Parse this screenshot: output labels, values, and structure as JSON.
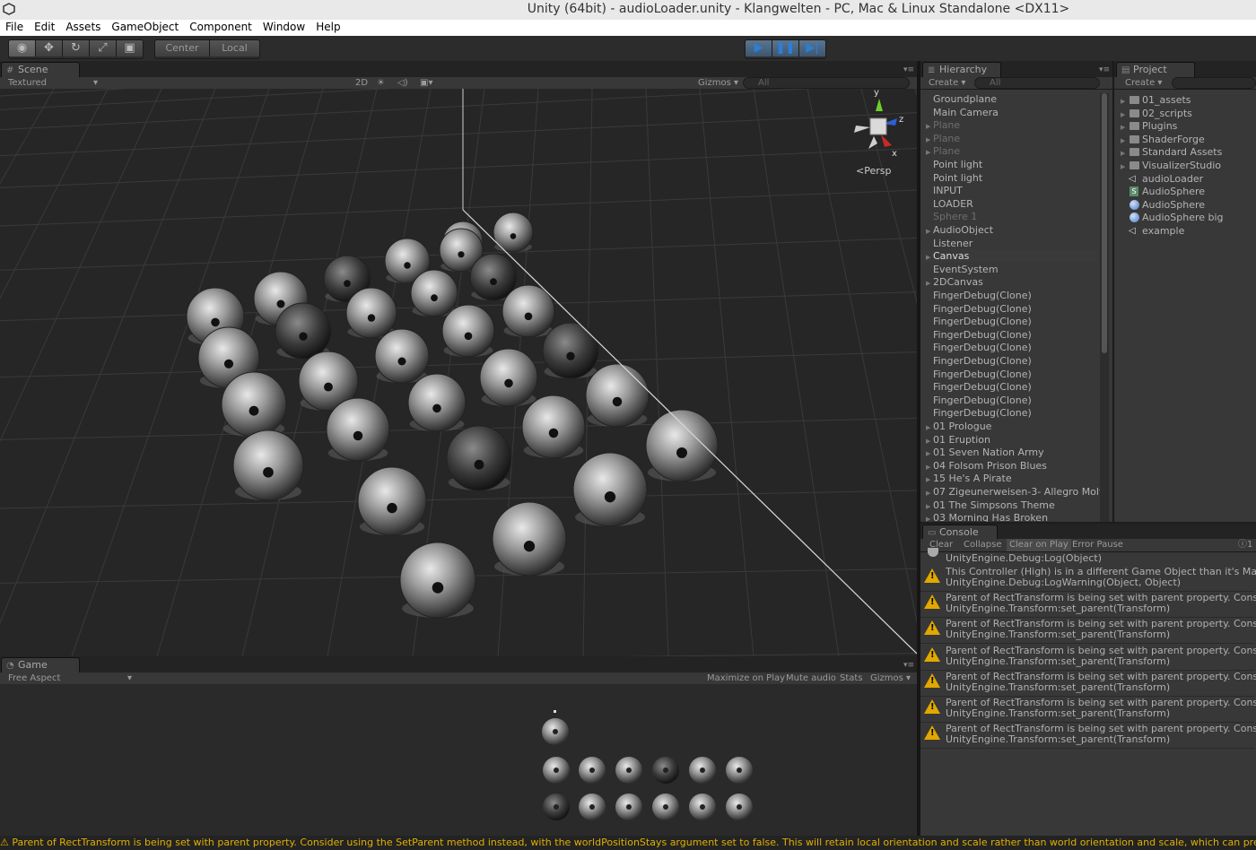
{
  "window": {
    "title": "Unity (64bit) - audioLoader.unity - Klangwelten - PC, Mac & Linux Standalone <DX11>"
  },
  "menu": [
    "File",
    "Edit",
    "Assets",
    "GameObject",
    "Component",
    "Window",
    "Help"
  ],
  "toolbar": {
    "pivot_label": "Center",
    "space_label": "Local"
  },
  "scene": {
    "tab_label": "Scene",
    "shading_mode": "Textured",
    "mode_2d": "2D",
    "gizmos_label": "Gizmos",
    "search_placeholder": "All",
    "persp_label": "Persp",
    "axis_y": "y",
    "axis_z": "z",
    "axis_x": "x"
  },
  "game": {
    "tab_label": "Game",
    "aspect": "Free Aspect",
    "maximize_on_play": "Maximize on Play",
    "mute_audio": "Mute audio",
    "stats": "Stats",
    "gizmos": "Gizmos"
  },
  "hierarchy": {
    "tab_label": "Hierarchy",
    "create_label": "Create",
    "search_placeholder": "All",
    "items": [
      {
        "label": "Groundplane",
        "arrow": false,
        "dim": false
      },
      {
        "label": "Main Camera",
        "arrow": false,
        "dim": false
      },
      {
        "label": "Plane",
        "arrow": true,
        "dim": true
      },
      {
        "label": "Plane",
        "arrow": true,
        "dim": true
      },
      {
        "label": "Plane",
        "arrow": true,
        "dim": true
      },
      {
        "label": "Point light",
        "arrow": false,
        "dim": false
      },
      {
        "label": "Point light",
        "arrow": false,
        "dim": false
      },
      {
        "label": "INPUT",
        "arrow": false,
        "dim": false
      },
      {
        "label": "LOADER",
        "arrow": false,
        "dim": false
      },
      {
        "label": "Sphere 1",
        "arrow": false,
        "dim": true
      },
      {
        "label": "AudioObject",
        "arrow": true,
        "dim": false
      },
      {
        "label": "Listener",
        "arrow": false,
        "dim": false
      },
      {
        "label": "Canvas",
        "arrow": true,
        "dim": false
      },
      {
        "label": "EventSystem",
        "arrow": false,
        "dim": false
      },
      {
        "label": "2DCanvas",
        "arrow": true,
        "dim": false
      },
      {
        "label": "FingerDebug(Clone)",
        "arrow": false,
        "dim": false
      },
      {
        "label": "FingerDebug(Clone)",
        "arrow": false,
        "dim": false
      },
      {
        "label": "FingerDebug(Clone)",
        "arrow": false,
        "dim": false
      },
      {
        "label": "FingerDebug(Clone)",
        "arrow": false,
        "dim": false
      },
      {
        "label": "FingerDebug(Clone)",
        "arrow": false,
        "dim": false
      },
      {
        "label": "FingerDebug(Clone)",
        "arrow": false,
        "dim": false
      },
      {
        "label": "FingerDebug(Clone)",
        "arrow": false,
        "dim": false
      },
      {
        "label": "FingerDebug(Clone)",
        "arrow": false,
        "dim": false
      },
      {
        "label": "FingerDebug(Clone)",
        "arrow": false,
        "dim": false
      },
      {
        "label": "FingerDebug(Clone)",
        "arrow": false,
        "dim": false
      },
      {
        "label": "01 Prologue",
        "arrow": true,
        "dim": false
      },
      {
        "label": "01 Eruption",
        "arrow": true,
        "dim": false
      },
      {
        "label": "01 Seven Nation Army",
        "arrow": true,
        "dim": false
      },
      {
        "label": "04 Folsom Prison Blues",
        "arrow": true,
        "dim": false
      },
      {
        "label": "15 He's A Pirate",
        "arrow": true,
        "dim": false
      },
      {
        "label": "07 Zigeunerweisen-3- Allegro Molto",
        "arrow": true,
        "dim": false
      },
      {
        "label": "01 The Simpsons Theme",
        "arrow": true,
        "dim": false
      },
      {
        "label": "03 Morning Has Broken",
        "arrow": true,
        "dim": false
      }
    ],
    "selected_index": 12
  },
  "project": {
    "tab_label": "Project",
    "create_label": "Create",
    "items": [
      {
        "label": "01_assets",
        "kind": "folder"
      },
      {
        "label": "02_scripts",
        "kind": "folder"
      },
      {
        "label": "Plugins",
        "kind": "folder"
      },
      {
        "label": "ShaderForge",
        "kind": "folder"
      },
      {
        "label": "Standard Assets",
        "kind": "folder"
      },
      {
        "label": "VisualizerStudio",
        "kind": "folder"
      },
      {
        "label": "audioLoader",
        "kind": "scene"
      },
      {
        "label": "AudioSphere",
        "kind": "script"
      },
      {
        "label": "AudioSphere",
        "kind": "material"
      },
      {
        "label": "AudioSphere big",
        "kind": "material"
      },
      {
        "label": "example",
        "kind": "scene"
      }
    ]
  },
  "console": {
    "tab_label": "Console",
    "buttons": [
      "Clear",
      "Collapse",
      "Clear on Play",
      "Error Pause"
    ],
    "info_count": "1",
    "first_line": "UnityEngine.Debug:Log(Object)",
    "entries": [
      {
        "line1": "This Controller (High) is in a different Game Object than it's Manag",
        "line2": "UnityEngine.Debug:LogWarning(Object, Object)"
      },
      {
        "line1": "Parent of RectTransform is being set with parent property. Conside",
        "line2": "UnityEngine.Transform:set_parent(Transform)"
      },
      {
        "line1": "Parent of RectTransform is being set with parent property. Conside",
        "line2": "UnityEngine.Transform:set_parent(Transform)"
      },
      {
        "line1": "Parent of RectTransform is being set with parent property. Conside",
        "line2": "UnityEngine.Transform:set_parent(Transform)"
      },
      {
        "line1": "Parent of RectTransform is being set with parent property. Conside",
        "line2": "UnityEngine.Transform:set_parent(Transform)"
      },
      {
        "line1": "Parent of RectTransform is being set with parent property. Conside",
        "line2": "UnityEngine.Transform:set_parent(Transform)"
      },
      {
        "line1": "Parent of RectTransform is being set with parent property. Conside",
        "line2": "UnityEngine.Transform:set_parent(Transform)"
      }
    ]
  },
  "status": {
    "message": "Parent of RectTransform is being set with parent property. Consider using the SetParent method instead, with the worldPositionStays argument set to false. This will retain local orientation and scale rather than world orientation and scale, which can prevent commo"
  },
  "colors": {
    "warning": "#e0a800",
    "play_accent": "#2a7fd4",
    "panel_bg": "#383838"
  }
}
